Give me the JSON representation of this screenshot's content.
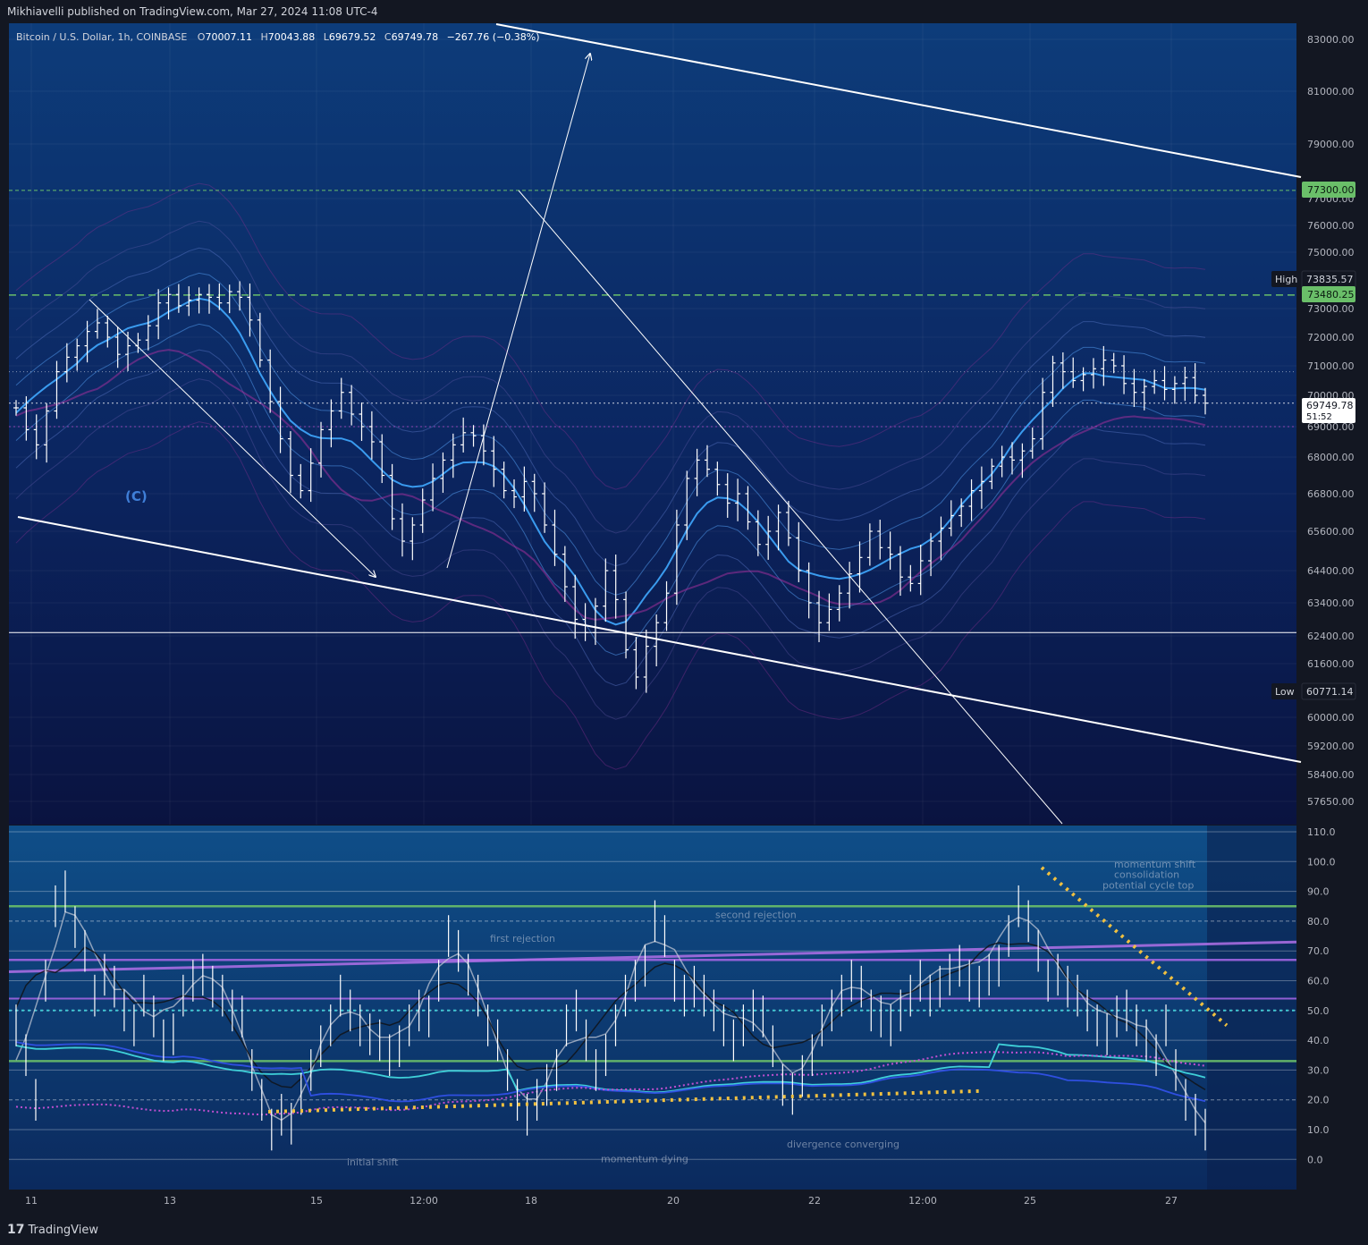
{
  "header": {
    "publisher": "Mikhiavelli published on TradingView.com, Mar 27, 2024 11:08 UTC-4"
  },
  "legend": {
    "symbol": "Bitcoin / U.S. Dollar, 1h, COINBASE",
    "o_label": "O",
    "o_value": "70007.11",
    "h_label": "H",
    "h_value": "70043.88",
    "l_label": "L",
    "l_value": "69679.52",
    "c_label": "C",
    "c_value": "69749.78",
    "change": "−267.76 (−0.38%)"
  },
  "footer": {
    "brand": "TradingView"
  },
  "colors": {
    "background_top": "#0d3c78",
    "background_bottom": "#0a1340",
    "candle": "#ffffff",
    "green_line": "#6abf69",
    "magenta": "#c04fd0",
    "cyan": "#3fd0d8",
    "blue_ma": "#2f4fe0",
    "yellow_dots": "#f0c040"
  },
  "chart_data": [
    {
      "type": "candlestick",
      "x_ticks": [
        "11",
        "13",
        "15",
        "12:00",
        "18",
        "20",
        "22",
        "12:00",
        "25",
        "27"
      ],
      "y_ticks": [
        "83000.00",
        "81000.00",
        "79000.00",
        "77000.00",
        "76000.00",
        "75000.00",
        "73000.00",
        "72000.00",
        "71000.00",
        "70000.00",
        "69000.00",
        "68000.00",
        "66800.00",
        "65600.00",
        "64400.00",
        "63400.00",
        "62400.00",
        "61600.00",
        "60000.00",
        "59200.00",
        "58400.00",
        "57650.00"
      ],
      "price_labels": [
        {
          "value": "77300.00",
          "kind": "green"
        },
        {
          "prefix": "High",
          "value": "73835.57",
          "kind": "dark"
        },
        {
          "value": "73480.25",
          "kind": "green"
        },
        {
          "value": "69749.78",
          "sub": "51:52",
          "kind": "white"
        },
        {
          "prefix": "Low",
          "value": "60771.14",
          "kind": "dark"
        }
      ],
      "annotations": [
        {
          "text": "(C)"
        }
      ],
      "levels": [
        77300,
        73480.25,
        62500
      ],
      "series_close": [
        69600,
        68900,
        68400,
        69500,
        70800,
        71300,
        71700,
        72200,
        72500,
        72000,
        71400,
        71700,
        71900,
        72400,
        73200,
        73500,
        73100,
        73300,
        73500,
        73400,
        73200,
        73600,
        73400,
        72600,
        71200,
        69800,
        68600,
        67400,
        66900,
        67800,
        68900,
        69500,
        70100,
        69400,
        69000,
        68500,
        67400,
        66000,
        65300,
        65800,
        66600,
        67300,
        67900,
        68400,
        68800,
        68700,
        68200,
        67600,
        66900,
        66700,
        67200,
        66800,
        65800,
        64900,
        63900,
        62900,
        62500,
        63300,
        64400,
        63500,
        62000,
        61200,
        62100,
        62800,
        63700,
        65800,
        67300,
        67900,
        67600,
        67100,
        66500,
        66800,
        65900,
        65200,
        65600,
        66200,
        65400,
        64400,
        63400,
        62800,
        63200,
        63700,
        64300,
        64800,
        65600,
        65100,
        64900,
        64200,
        64000,
        64700,
        65300,
        65700,
        66100,
        66400,
        66900,
        67200,
        67700,
        68000,
        67900,
        68200,
        68600,
        70100,
        71100,
        70800,
        70500,
        70700,
        70900,
        71200,
        71000,
        70400,
        70100,
        70300,
        70500,
        70200,
        70400,
        70600,
        70000,
        69750
      ]
    },
    {
      "type": "line",
      "y_ticks": [
        "110.0",
        "100.0",
        "90.0",
        "80.0",
        "70.0",
        "60.0",
        "50.0",
        "40.0",
        "30.0",
        "20.0",
        "10.0",
        "0.0"
      ],
      "annotations": [
        {
          "text": "first rejection"
        },
        {
          "text": "second rejection"
        },
        {
          "text": "initial shift"
        },
        {
          "text": "momentum dying"
        },
        {
          "text": "divergence converging"
        },
        {
          "text": "momentum shift"
        },
        {
          "text": "consolidation"
        },
        {
          "text": "potential cycle top"
        }
      ],
      "series_osc": [
        45,
        35,
        20,
        60,
        85,
        90,
        78,
        70,
        55,
        62,
        58,
        50,
        45,
        55,
        48,
        40,
        42,
        55,
        60,
        62,
        58,
        55,
        50,
        48,
        30,
        20,
        10,
        15,
        12,
        22,
        30,
        38,
        45,
        55,
        50,
        45,
        42,
        40,
        35,
        38,
        45,
        50,
        48,
        60,
        75,
        70,
        62,
        55,
        45,
        40,
        30,
        20,
        15,
        20,
        25,
        30,
        45,
        50,
        40,
        30,
        35,
        45,
        55,
        60,
        65,
        80,
        75,
        60,
        55,
        58,
        55,
        50,
        45,
        40,
        45,
        50,
        48,
        38,
        25,
        22,
        28,
        35,
        45,
        50,
        55,
        60,
        58,
        50,
        48,
        45,
        50,
        55,
        60,
        55,
        58,
        62,
        65,
        60,
        58,
        62,
        65,
        75,
        85,
        80,
        70,
        60,
        62,
        58,
        55,
        50,
        45,
        42,
        48,
        50,
        45,
        40,
        35,
        45,
        30,
        20,
        15,
        10
      ]
    }
  ]
}
